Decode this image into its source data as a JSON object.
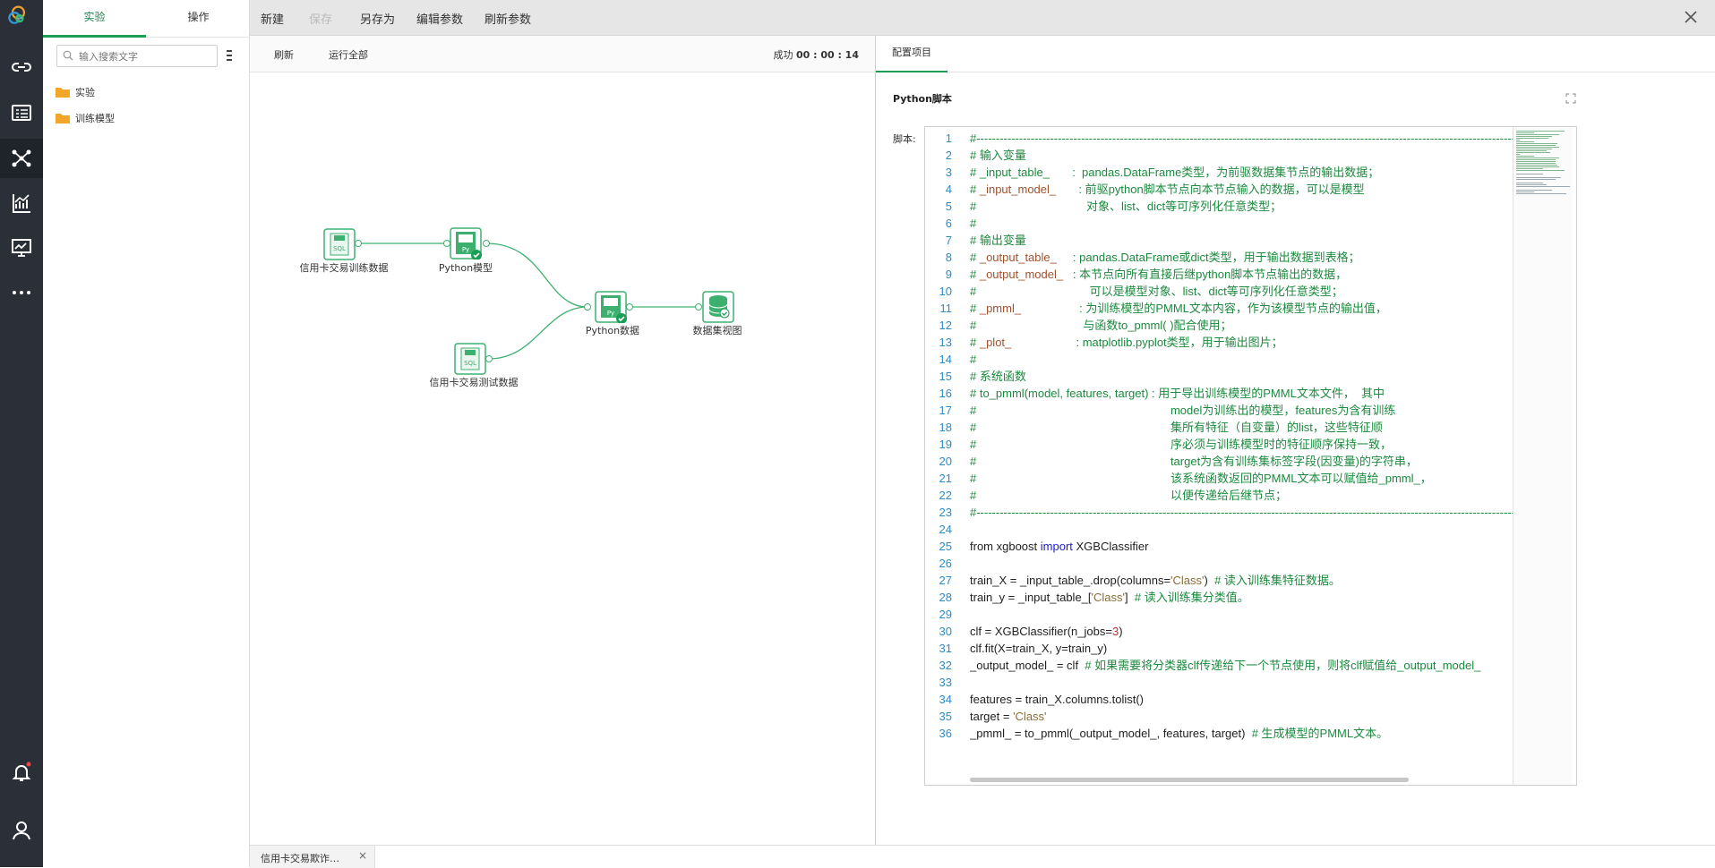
{
  "colors": {
    "accent": "#1a9e55",
    "rail": "#2b3038",
    "toolbar": "#e6e6e6"
  },
  "rail": {
    "icons": [
      "app-logo",
      "link-icon",
      "list-icon",
      "graph-icon",
      "chart-icon",
      "monitor-icon",
      "more-icon",
      "bell-icon",
      "user-icon"
    ]
  },
  "tree": {
    "tabs": [
      "实验",
      "操作"
    ],
    "search_placeholder": "输入搜索文字",
    "items": [
      "实验",
      "训练模型"
    ]
  },
  "toolbar": {
    "new": "新建",
    "save": "保存",
    "save_as": "另存为",
    "edit_params": "编辑参数",
    "refresh_params": "刷新参数"
  },
  "canvas": {
    "refresh": "刷新",
    "run_all": "运行全部",
    "status_label": "成功",
    "status_time": "00 : 00 : 14",
    "nodes": {
      "train_data": "信用卡交易训练数据",
      "python_model": "Python模型",
      "test_data": "信用卡交易测试数据",
      "python_data": "Python数据",
      "dataset_view": "数据集视图"
    }
  },
  "config": {
    "tab": "配置项目",
    "title": "Python脚本",
    "script_label": "脚本:",
    "line_numbers": [
      "1",
      "2",
      "3",
      "4",
      "5",
      "6",
      "7",
      "8",
      "9",
      "10",
      "11",
      "12",
      "13",
      "14",
      "15",
      "16",
      "17",
      "18",
      "19",
      "20",
      "21",
      "22",
      "23",
      "24",
      "25",
      "26",
      "27",
      "28",
      "29",
      "30",
      "31",
      "32",
      "33",
      "34",
      "35",
      "36"
    ],
    "code": {
      "l1": "#--------------------------------------------------------------------------------------------------------------------------------------------------------------------",
      "l2": "# 输入变量",
      "l3": "# _input_table_       :  pandas.DataFrame类型，为前驱数据集节点的输出数据；",
      "l4a": "# ",
      "l4b": "_input_model_",
      "l4c": "       : 前驱python脚本节点向本节点输入的数据，可以是模型",
      "l5": "#                                  对象、list、dict等可序列化任意类型；",
      "l6": "#",
      "l7": "# 输出变量",
      "l8a": "# ",
      "l8b": "_output_table_",
      "l8c": "     : pandas.DataFrame或dict类型，用于输出数据到表格；",
      "l9a": "# ",
      "l9b": "_output_model_",
      "l9c": "   : 本节点向所有直接后继python脚本节点输出的数据，",
      "l10": "#                                   可以是模型对象、list、dict等可序列化任意类型；",
      "l11a": "# ",
      "l11b": "_pmml_",
      "l11c": "                  : 为训练模型的PMML文本内容，作为该模型节点的输出值，",
      "l12": "#                                 与函数to_pmml( )配合使用；",
      "l13a": "# ",
      "l13b": "_plot_",
      "l13c": "                    : matplotlib.pyplot类型，用于输出图片；",
      "l14": "#",
      "l15": "# 系统函数",
      "l16": "# to_pmml(model, features, target) : 用于导出训练模型的PMML文本文件，  其中",
      "l17": "#                                                            model为训练出的模型，features为含有训练",
      "l18": "#                                                            集所有特征（自变量）的list，这些特征顺",
      "l19": "#                                                            序必须与训练模型时的特征顺序保持一致，",
      "l20": "#                                                            target为含有训练集标签字段(因变量)的字符串，",
      "l21": "#                                                            该系统函数返回的PMML文本可以赋值给_pmml_，",
      "l22": "#                                                            以便传递给后继节点；",
      "l23": "#--------------------------------------------------------------------------------------------------------------------------------------------------------------------",
      "l24": "",
      "l25a": "from xgboost ",
      "l25b": "import",
      "l25c": " XGBClassifier",
      "l26": "",
      "l27a": "train_X = _input_table_.drop(columns=",
      "l27b": "'Class'",
      "l27c": ")  ",
      "l27d": "# 读入训练集特征数据。",
      "l28a": "train_y = _input_table_[",
      "l28b": "'Class'",
      "l28c": "]  ",
      "l28d": "# 读入训练集分类值。",
      "l29": "",
      "l30a": "clf = XGBClassifier(n_jobs=",
      "l30b": "3",
      "l30c": ")",
      "l31": "clf.fit(X=train_X, y=train_y)",
      "l32a": "_output_model_ = clf  ",
      "l32b": "# 如果需要将分类器clf传递给下一个节点使用，则将clf赋值给_output_model_",
      "l33": "",
      "l34": "features = train_X.columns.tolist()",
      "l35a": "target = ",
      "l35b": "'Class'",
      "l36a": "_pmml_ = to_pmml(_output_model_, features, target)  ",
      "l36b": "# 生成模型的PMML文本。"
    }
  },
  "bottom": {
    "tab": "信用卡交易欺诈…",
    "close": "×"
  }
}
